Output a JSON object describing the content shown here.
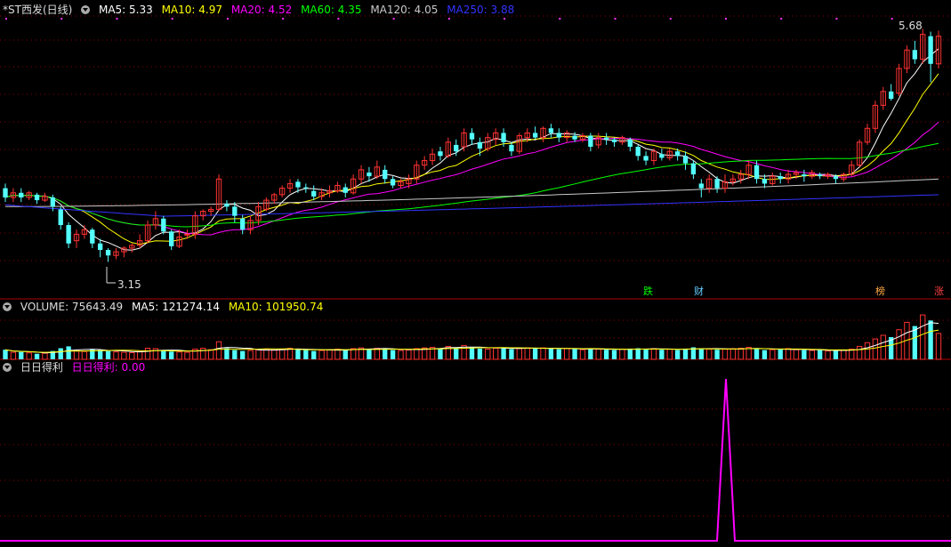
{
  "header": {
    "stock": "*ST西发(日线)",
    "ma5": "MA5: 5.33",
    "ma10": "MA10: 4.97",
    "ma20": "MA20: 4.52",
    "ma60": "MA60: 4.35",
    "ma120": "MA120: 4.05",
    "ma250": "MA250: 3.88"
  },
  "volume_header": {
    "label": "VOLUME: 75643.49",
    "ma5": "MA5: 121274.14",
    "ma10": "MA10: 101950.74"
  },
  "indicator_header": {
    "name": "日日得利",
    "value": "日日得利: 0.00"
  },
  "annotations": {
    "high": "5.68",
    "low": "3.15",
    "tag_die": "跌",
    "tag_cai": "财",
    "tag_bang": "榜",
    "tag_zhang": "涨"
  },
  "colors": {
    "up": "#ff3232",
    "down": "#54ffff",
    "ma5": "#ffffff",
    "ma10": "#ffff00",
    "ma20": "#ff00ff",
    "ma60": "#00ff00",
    "ma120": "#c8c8c8",
    "ma250": "#3333ff",
    "indicator": "#ff00ff",
    "grid": "#8b0000"
  },
  "chart_data": [
    {
      "type": "candlestick",
      "title": "*ST西发(日线)",
      "ylim": [
        3.0,
        5.8
      ],
      "high_label": 5.68,
      "low_label": 3.15,
      "candles": [
        [
          3.95,
          3.85,
          4.0,
          3.8
        ],
        [
          3.85,
          3.9,
          3.95,
          3.8
        ],
        [
          3.9,
          3.85,
          3.95,
          3.8
        ],
        [
          3.85,
          3.9,
          3.92,
          3.82
        ],
        [
          3.88,
          3.82,
          3.9,
          3.78
        ],
        [
          3.82,
          3.86,
          3.9,
          3.8
        ],
        [
          3.85,
          3.75,
          3.88,
          3.7
        ],
        [
          3.72,
          3.55,
          3.75,
          3.5
        ],
        [
          3.55,
          3.35,
          3.58,
          3.3
        ],
        [
          3.38,
          3.45,
          3.5,
          3.3
        ],
        [
          3.45,
          3.5,
          3.55,
          3.4
        ],
        [
          3.5,
          3.35,
          3.52,
          3.3
        ],
        [
          3.35,
          3.28,
          3.4,
          3.2
        ],
        [
          3.28,
          3.22,
          3.3,
          3.15
        ],
        [
          3.22,
          3.26,
          3.3,
          3.18
        ],
        [
          3.26,
          3.3,
          3.32,
          3.2
        ],
        [
          3.3,
          3.33,
          3.35,
          3.25
        ],
        [
          3.33,
          3.38,
          3.45,
          3.3
        ],
        [
          3.38,
          3.55,
          3.6,
          3.35
        ],
        [
          3.55,
          3.62,
          3.7,
          3.5
        ],
        [
          3.62,
          3.48,
          3.65,
          3.45
        ],
        [
          3.48,
          3.32,
          3.5,
          3.28
        ],
        [
          3.32,
          3.42,
          3.5,
          3.3
        ],
        [
          3.45,
          3.45,
          3.5,
          3.4
        ],
        [
          3.45,
          3.65,
          3.7,
          3.4
        ],
        [
          3.65,
          3.7,
          3.72,
          3.6
        ],
        [
          3.7,
          3.72,
          3.75,
          3.65
        ],
        [
          3.72,
          4.05,
          4.1,
          3.7
        ],
        [
          3.78,
          3.75,
          3.82,
          3.7
        ],
        [
          3.75,
          3.65,
          3.8,
          3.58
        ],
        [
          3.62,
          3.5,
          3.66,
          3.45
        ],
        [
          3.5,
          3.6,
          3.65,
          3.45
        ],
        [
          3.6,
          3.75,
          3.8,
          3.55
        ],
        [
          3.72,
          3.82,
          3.85,
          3.7
        ],
        [
          3.82,
          3.88,
          3.9,
          3.78
        ],
        [
          3.88,
          3.95,
          3.98,
          3.85
        ],
        [
          3.95,
          4.0,
          4.05,
          3.9
        ],
        [
          4.02,
          3.96,
          4.05,
          3.9
        ],
        [
          3.96,
          3.95,
          4.0,
          3.9
        ],
        [
          3.92,
          3.86,
          3.98,
          3.82
        ],
        [
          3.86,
          3.9,
          3.95,
          3.82
        ],
        [
          3.9,
          3.92,
          3.98,
          3.85
        ],
        [
          3.92,
          3.98,
          4.02,
          3.9
        ],
        [
          3.96,
          3.9,
          4.0,
          3.85
        ],
        [
          3.9,
          4.05,
          4.1,
          3.88
        ],
        [
          4.05,
          4.15,
          4.2,
          4.0
        ],
        [
          4.12,
          4.08,
          4.18,
          4.02
        ],
        [
          4.08,
          4.18,
          4.25,
          4.05
        ],
        [
          4.15,
          4.05,
          4.2,
          4.0
        ],
        [
          4.05,
          3.98,
          4.08,
          3.95
        ],
        [
          3.98,
          4.02,
          4.05,
          3.95
        ],
        [
          4.0,
          4.05,
          4.1,
          3.95
        ],
        [
          4.05,
          4.2,
          4.25,
          4.0
        ],
        [
          4.2,
          4.25,
          4.3,
          4.15
        ],
        [
          4.25,
          4.32,
          4.38,
          4.2
        ],
        [
          4.35,
          4.3,
          4.4,
          4.25
        ],
        [
          4.3,
          4.45,
          4.5,
          4.28
        ],
        [
          4.42,
          4.35,
          4.48,
          4.3
        ],
        [
          4.4,
          4.55,
          4.6,
          4.35
        ],
        [
          4.55,
          4.48,
          4.6,
          4.42
        ],
        [
          4.45,
          4.38,
          4.5,
          4.3
        ],
        [
          4.38,
          4.5,
          4.55,
          4.35
        ],
        [
          4.48,
          4.55,
          4.6,
          4.42
        ],
        [
          4.55,
          4.45,
          4.6,
          4.4
        ],
        [
          4.42,
          4.35,
          4.45,
          4.3
        ],
        [
          4.35,
          4.52,
          4.55,
          4.32
        ],
        [
          4.5,
          4.55,
          4.6,
          4.45
        ],
        [
          4.55,
          4.5,
          4.62,
          4.48
        ],
        [
          4.5,
          4.6,
          4.62,
          4.45
        ],
        [
          4.6,
          4.55,
          4.65,
          4.5
        ],
        [
          4.55,
          4.5,
          4.6,
          4.45
        ],
        [
          4.5,
          4.55,
          4.58,
          4.45
        ],
        [
          4.52,
          4.48,
          4.56,
          4.45
        ],
        [
          4.48,
          4.52,
          4.55,
          4.45
        ],
        [
          4.52,
          4.4,
          4.55,
          4.35
        ],
        [
          4.42,
          4.5,
          4.55,
          4.38
        ],
        [
          4.5,
          4.48,
          4.55,
          4.42
        ],
        [
          4.48,
          4.45,
          4.5,
          4.4
        ],
        [
          4.45,
          4.5,
          4.52,
          4.42
        ],
        [
          4.48,
          4.4,
          4.5,
          4.35
        ],
        [
          4.4,
          4.3,
          4.42,
          4.25
        ],
        [
          4.3,
          4.25,
          4.35,
          4.2
        ],
        [
          4.25,
          4.35,
          4.38,
          4.2
        ],
        [
          4.32,
          4.28,
          4.38,
          4.25
        ],
        [
          4.28,
          4.35,
          4.38,
          4.25
        ],
        [
          4.35,
          4.3,
          4.38,
          4.25
        ],
        [
          4.3,
          4.22,
          4.35,
          4.15
        ],
        [
          4.22,
          4.1,
          4.25,
          4.05
        ],
        [
          4.0,
          3.95,
          4.05,
          3.85
        ],
        [
          3.95,
          4.05,
          4.1,
          3.9
        ],
        [
          4.05,
          3.95,
          4.08,
          3.9
        ],
        [
          3.95,
          4.02,
          4.1,
          3.9
        ],
        [
          4.02,
          4.05,
          4.1,
          3.98
        ],
        [
          4.05,
          4.1,
          4.15,
          4.0
        ],
        [
          4.1,
          4.2,
          4.25,
          4.05
        ],
        [
          4.2,
          4.05,
          4.25,
          4.0
        ],
        [
          4.05,
          4.0,
          4.1,
          3.95
        ],
        [
          4.0,
          4.08,
          4.12,
          3.98
        ],
        [
          4.08,
          4.05,
          4.12,
          4.0
        ],
        [
          4.05,
          4.1,
          4.15,
          4.0
        ],
        [
          4.1,
          4.12,
          4.15,
          4.05
        ],
        [
          4.1,
          4.08,
          4.15,
          4.02
        ],
        [
          4.08,
          4.12,
          4.15,
          4.05
        ],
        [
          4.1,
          4.08,
          4.12,
          4.05
        ],
        [
          4.08,
          4.1,
          4.12,
          4.05
        ],
        [
          4.08,
          4.05,
          4.1,
          4.0
        ],
        [
          4.05,
          4.1,
          4.12,
          4.02
        ],
        [
          4.1,
          4.2,
          4.25,
          4.08
        ],
        [
          4.2,
          4.45,
          4.48,
          4.18
        ],
        [
          4.45,
          4.6,
          4.65,
          4.42
        ],
        [
          4.6,
          4.85,
          4.9,
          4.55
        ],
        [
          4.85,
          5.0,
          5.05,
          4.8
        ],
        [
          5.0,
          4.92,
          5.08,
          4.9
        ],
        [
          4.98,
          5.25,
          5.3,
          4.95
        ],
        [
          5.25,
          5.45,
          5.5,
          5.2
        ],
        [
          5.45,
          5.35,
          5.55,
          5.3
        ],
        [
          5.35,
          5.62,
          5.68,
          5.3
        ],
        [
          5.6,
          5.3,
          5.65,
          5.1
        ],
        [
          5.3,
          5.6,
          5.66,
          5.25
        ]
      ],
      "volume": [
        52,
        38,
        40,
        35,
        30,
        33,
        45,
        60,
        70,
        48,
        42,
        55,
        50,
        45,
        40,
        38,
        36,
        42,
        60,
        58,
        48,
        42,
        40,
        38,
        55,
        60,
        52,
        95,
        60,
        50,
        45,
        48,
        52,
        55,
        50,
        55,
        60,
        58,
        50,
        45,
        48,
        52,
        55,
        50,
        58,
        62,
        55,
        60,
        58,
        50,
        48,
        50,
        58,
        62,
        65,
        60,
        70,
        62,
        75,
        65,
        58,
        55,
        60,
        65,
        55,
        58,
        62,
        60,
        62,
        58,
        55,
        58,
        55,
        52,
        60,
        55,
        52,
        50,
        55,
        58,
        60,
        55,
        58,
        52,
        55,
        50,
        58,
        65,
        60,
        55,
        52,
        55,
        58,
        60,
        65,
        55,
        50,
        52,
        55,
        58,
        52,
        50,
        48,
        50,
        45,
        48,
        50,
        55,
        70,
        90,
        110,
        130,
        120,
        160,
        200,
        180,
        240,
        210,
        140
      ],
      "indicator": "日日得利: 0.00 (single spike near day ~96)"
    }
  ]
}
